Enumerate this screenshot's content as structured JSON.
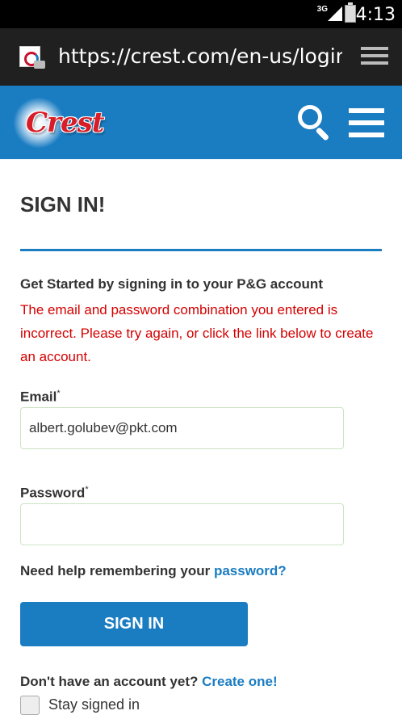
{
  "status_bar": {
    "network": "3G",
    "time": "4:13"
  },
  "browser": {
    "url": "https://crest.com/en-us/loginpa"
  },
  "header": {
    "logo_text": "Crest"
  },
  "page": {
    "title": "SIGN IN!",
    "intro": "Get Started by signing in to your P&G account",
    "error": "The email and password combination you entered is incorrect. Please try again, or click the link below to create an account."
  },
  "form": {
    "email_label": "Email",
    "email_required": "*",
    "email_value": "albert.golubev@pkt.com",
    "password_label": "Password",
    "password_required": "*",
    "password_value": "",
    "help_text": "Need help remembering your ",
    "help_link": "password?",
    "submit_label": "SIGN IN",
    "no_account_text": "Don't have an account yet? ",
    "create_link": "Create one!",
    "stay_signed_in": "Stay signed in"
  }
}
